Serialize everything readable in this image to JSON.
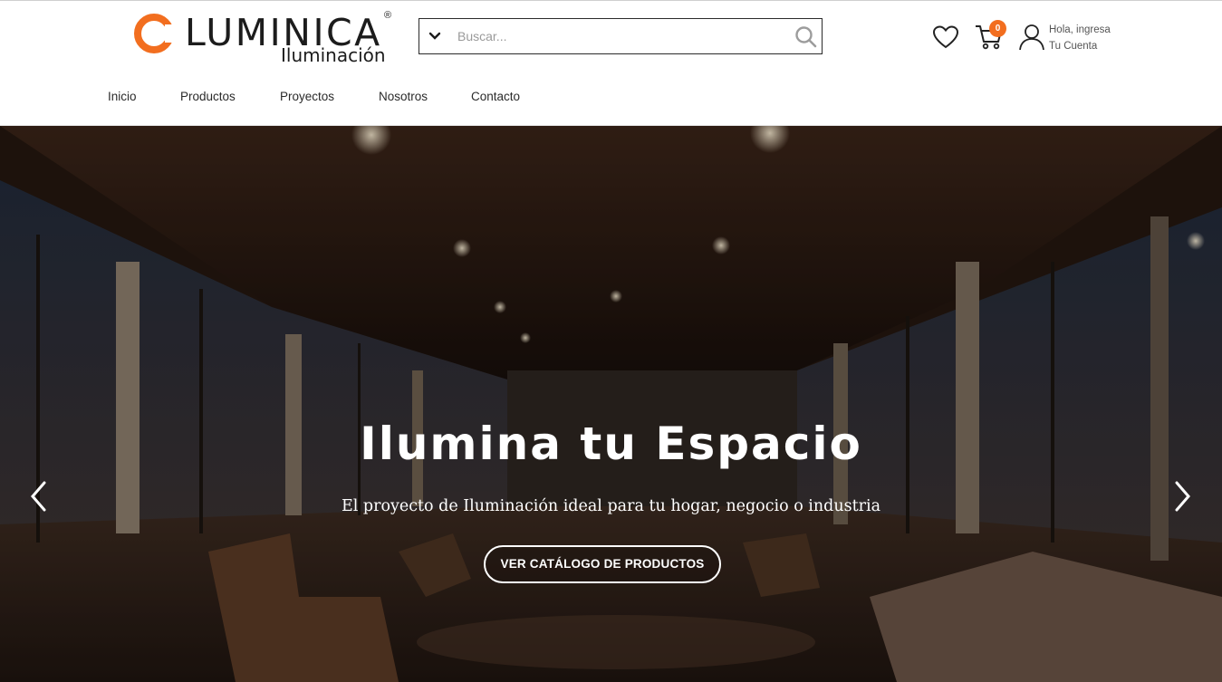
{
  "brand": {
    "name": "LUMINICA",
    "sub": "Iluminación",
    "registered": "®",
    "accent_color": "#f26e1f"
  },
  "search": {
    "placeholder": "Buscar...",
    "value": ""
  },
  "header_icons": {
    "wishlist": "heart-icon",
    "cart": "cart-icon",
    "cart_count": "0",
    "account_icon": "user-icon"
  },
  "account": {
    "line1": "Hola, ingresa",
    "line2": "Tu Cuenta"
  },
  "nav": {
    "items": [
      {
        "label": "Inicio"
      },
      {
        "label": "Productos"
      },
      {
        "label": "Proyectos"
      },
      {
        "label": "Nosotros"
      },
      {
        "label": "Contacto"
      }
    ]
  },
  "hero": {
    "title": "Ilumina tu Espacio",
    "subtitle": "El proyecto de Iluminación ideal para tu hogar, negocio o industria",
    "cta": "VER CATÁLOGO DE PRODUCTOS",
    "prev_icon": "chevron-left-icon",
    "next_icon": "chevron-right-icon"
  }
}
